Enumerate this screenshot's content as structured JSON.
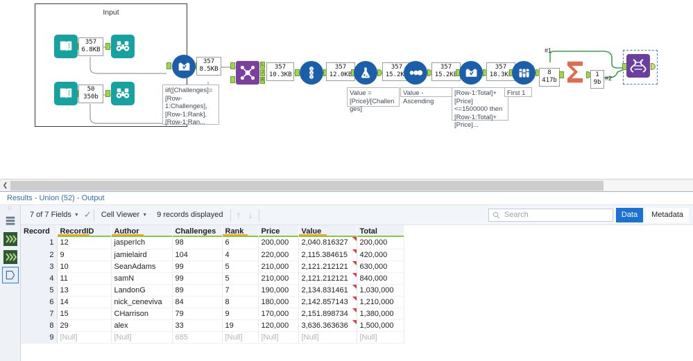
{
  "canvas": {
    "container": {
      "title": "Input"
    },
    "tools": [
      {
        "id": "input1",
        "name": "input-data-tool-1",
        "icon": "book-icon"
      },
      {
        "id": "browse1",
        "name": "browse-tool-1",
        "icon": "binoculars-icon"
      },
      {
        "id": "input2",
        "name": "input-data-tool-2",
        "icon": "book-icon"
      },
      {
        "id": "browse2",
        "name": "browse-tool-2",
        "icon": "binoculars-icon"
      },
      {
        "id": "multirow1",
        "name": "multi-row-formula-tool-1",
        "icon": "multi-row-formula-icon"
      },
      {
        "id": "join",
        "name": "join-tool",
        "icon": "join-icon"
      },
      {
        "id": "recordid",
        "name": "record-id-tool",
        "icon": "record-id-icon"
      },
      {
        "id": "formula",
        "name": "formula-tool",
        "icon": "flask-icon"
      },
      {
        "id": "sort",
        "name": "sort-tool",
        "icon": "sort-icon"
      },
      {
        "id": "multirow2",
        "name": "multi-row-formula-tool-2",
        "icon": "multi-row-formula-icon"
      },
      {
        "id": "sample",
        "name": "sample-tool",
        "icon": "test-tubes-icon"
      },
      {
        "id": "summarize",
        "name": "summarize-tool",
        "icon": "sigma-icon"
      },
      {
        "id": "union",
        "name": "union-tool",
        "icon": "union-icon"
      }
    ],
    "record_boxes": [
      {
        "id": "rc1",
        "records": "357",
        "size": "6.8KB"
      },
      {
        "id": "rc2",
        "records": "50",
        "size": "350b"
      },
      {
        "id": "rc3",
        "records": "357",
        "size": "8.5KB"
      },
      {
        "id": "rc4",
        "records": "357",
        "size": "10.3KB"
      },
      {
        "id": "rc5",
        "records": "357",
        "size": "12.0KB"
      },
      {
        "id": "rc6",
        "records": "357",
        "size": "15.2KB"
      },
      {
        "id": "rc7",
        "records": "357",
        "size": "15.2KB"
      },
      {
        "id": "rc8",
        "records": "357",
        "size": "18.3KB"
      },
      {
        "id": "rc9",
        "records": "8",
        "size": "417b"
      },
      {
        "id": "rc10",
        "records": "1",
        "size": "9b"
      }
    ],
    "annotations": [
      {
        "id": "a1",
        "text": "iif([Challenges]=[Row-1:Challenges],[Row-1:Rank],[Row-1:Ran..."
      },
      {
        "id": "a2",
        "text": "Value = [Price]/[Challenges]"
      },
      {
        "id": "a3",
        "text": "Value - Ascending"
      },
      {
        "id": "a4",
        "text": "[Row-1:Total]+[Price] <=1500000 then [Row-1:Total]+[Price]..."
      },
      {
        "id": "a5",
        "text": "First 1"
      }
    ],
    "connection_labels": [
      {
        "id": "c1",
        "text": "#1"
      },
      {
        "id": "c2",
        "text": "#2"
      }
    ],
    "join_anchors": [
      "L",
      "J",
      "R"
    ]
  },
  "results": {
    "title": "Results - Union (52) - Output",
    "toolbar": {
      "fields": "7 of 7 Fields",
      "viewer": "Cell Viewer",
      "records": "9 records displayed",
      "up_arrow": "↑",
      "down_arrow": "↓"
    },
    "search": {
      "placeholder": "Search",
      "value": ""
    },
    "tabs": {
      "data": "Data",
      "metadata": "Metadata"
    },
    "columns": [
      "Record",
      "RecordID",
      "Author",
      "Challenges",
      "Rank",
      "Price",
      "Value",
      "Total"
    ],
    "rows": [
      {
        "record": "1",
        "recordid": "12",
        "author": "jasperIch",
        "challenges": "98",
        "rank": "6",
        "price": "200,000",
        "value": "2,040.816327",
        "total": "200,000",
        "flag": true,
        "null": false
      },
      {
        "record": "2",
        "recordid": "9",
        "author": "jamielaird",
        "challenges": "104",
        "rank": "4",
        "price": "220,000",
        "value": "2,115.384615",
        "total": "420,000",
        "flag": true,
        "null": false
      },
      {
        "record": "3",
        "recordid": "10",
        "author": "SeanAdams",
        "challenges": "99",
        "rank": "5",
        "price": "210,000",
        "value": "2,121.212121",
        "total": "630,000",
        "flag": true,
        "null": false
      },
      {
        "record": "4",
        "recordid": "11",
        "author": "samN",
        "challenges": "99",
        "rank": "5",
        "price": "210,000",
        "value": "2,121.212121",
        "total": "840,000",
        "flag": true,
        "null": false
      },
      {
        "record": "5",
        "recordid": "13",
        "author": "LandonG",
        "challenges": "89",
        "rank": "7",
        "price": "190,000",
        "value": "2,134.831461",
        "total": "1,030,000",
        "flag": true,
        "null": false
      },
      {
        "record": "6",
        "recordid": "14",
        "author": "nick_ceneviva",
        "challenges": "84",
        "rank": "8",
        "price": "180,000",
        "value": "2,142.857143",
        "total": "1,210,000",
        "flag": true,
        "null": false
      },
      {
        "record": "7",
        "recordid": "15",
        "author": "CHarrison",
        "challenges": "79",
        "rank": "9",
        "price": "170,000",
        "value": "2,151.898734",
        "total": "1,380,000",
        "flag": true,
        "null": false
      },
      {
        "record": "8",
        "recordid": "29",
        "author": "alex",
        "challenges": "33",
        "rank": "19",
        "price": "120,000",
        "value": "3,636.363636",
        "total": "1,500,000",
        "flag": true,
        "null": false
      },
      {
        "record": "9",
        "recordid": "[Null]",
        "author": "[Null]",
        "challenges": "685",
        "rank": "[Null]",
        "price": "[Null]",
        "value": "[Null]",
        "total": "[Null]",
        "flag": false,
        "null": true
      }
    ]
  },
  "colors": {
    "teal": "#17a2a2",
    "navy": "#1b5faa",
    "join_purple": "#7b3fa0",
    "union_purple": "#6b3fa0",
    "summarize_salmon": "#e4694f",
    "anchor_green": "#9fd44d",
    "wire_green": "#3aa650",
    "tab_blue": "#1a73d4",
    "title_blue": "#2f6fba",
    "header_underline_green": "#8cc63f",
    "header_underline_orange": "#f5a623",
    "flag_red": "#e53935"
  }
}
